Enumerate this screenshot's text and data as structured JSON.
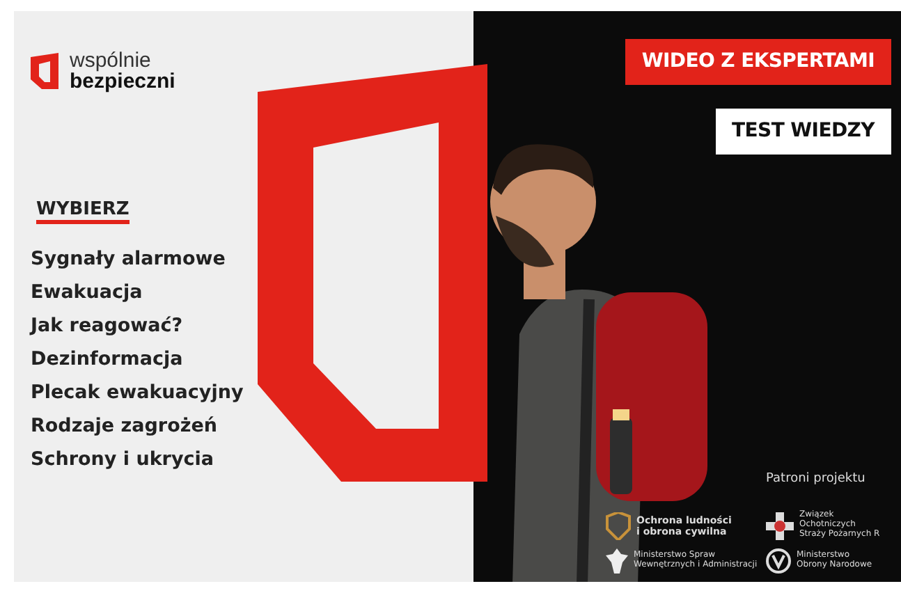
{
  "logo": {
    "line1": "wspólnie",
    "line2": "bezpieczni"
  },
  "buttons": [
    {
      "label": "WIDEO Z EKSPERTAMI",
      "kind": "primary"
    },
    {
      "label": "TEST WIEDZY",
      "kind": "secondary"
    }
  ],
  "menu": {
    "heading": "WYBIERZ",
    "items": [
      "Sygnały alarmowe",
      "Ewakuacja",
      "Jak reagować?",
      "Dezinformacja",
      "Plecak ewakuacyjny",
      "Rodzaje zagrożeń",
      "Schrony i ukrycia"
    ]
  },
  "patrons": {
    "heading": "Patroni projektu",
    "items": [
      {
        "kind": "civil",
        "lines": [
          "Ochrona ludności",
          "i obrona cywilna"
        ]
      },
      {
        "kind": "firefighters",
        "lines": [
          "Związek",
          "Ochotniczych",
          "Straży Pożarnych R"
        ]
      },
      {
        "kind": "eagle",
        "lines": [
          "Ministerstwo Spraw",
          "Wewnętrznych i Administracji"
        ]
      },
      {
        "kind": "defence",
        "lines": [
          "Ministerstwo",
          "Obrony Narodowe"
        ]
      }
    ]
  }
}
